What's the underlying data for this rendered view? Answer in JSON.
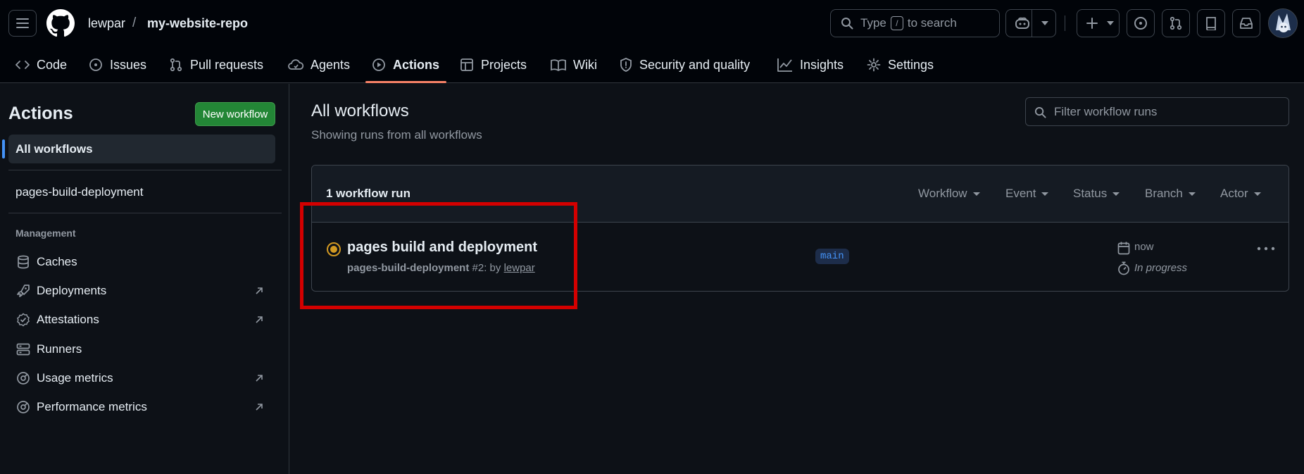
{
  "header": {
    "owner": "lewpar",
    "separator": "/",
    "repo": "my-website-repo",
    "search_prefix": "Type",
    "search_key": "/",
    "search_suffix": "to search"
  },
  "tabs": [
    {
      "label": "Code",
      "icon": "code-icon"
    },
    {
      "label": "Issues",
      "icon": "issue-icon"
    },
    {
      "label": "Pull requests",
      "icon": "pull-request-icon"
    },
    {
      "label": "Agents",
      "icon": "agent-icon"
    },
    {
      "label": "Actions",
      "icon": "play-icon",
      "active": true
    },
    {
      "label": "Projects",
      "icon": "table-icon"
    },
    {
      "label": "Wiki",
      "icon": "book-icon"
    },
    {
      "label": "Security and quality",
      "icon": "shield-icon"
    },
    {
      "label": "Insights",
      "icon": "graph-icon"
    },
    {
      "label": "Settings",
      "icon": "gear-icon"
    }
  ],
  "sidebar": {
    "title": "Actions",
    "new_workflow": "New workflow",
    "all_workflows": "All workflows",
    "workflows": [
      "pages-build-deployment"
    ],
    "management_heading": "Management",
    "management": [
      {
        "label": "Caches",
        "icon": "database-icon",
        "external": false
      },
      {
        "label": "Deployments",
        "icon": "rocket-icon",
        "external": true
      },
      {
        "label": "Attestations",
        "icon": "verified-icon",
        "external": true
      },
      {
        "label": "Runners",
        "icon": "server-icon",
        "external": false
      },
      {
        "label": "Usage metrics",
        "icon": "meter-icon",
        "external": true
      },
      {
        "label": "Performance metrics",
        "icon": "meter-icon",
        "external": true
      }
    ]
  },
  "main": {
    "title": "All workflows",
    "subtitle": "Showing runs from all workflows",
    "filter_placeholder": "Filter workflow runs",
    "run_count": "1 workflow run",
    "filters": [
      "Workflow",
      "Event",
      "Status",
      "Branch",
      "Actor"
    ],
    "run": {
      "title": "pages build and deployment",
      "workflow": "pages-build-deployment",
      "number_by": "#2: by",
      "actor": "lewpar",
      "branch": "main",
      "time": "now",
      "duration": "In progress",
      "status_color": "#d29922"
    }
  },
  "colors": {
    "accent": "#f78166",
    "primary_button": "#238636",
    "annotation": "#d40000"
  }
}
